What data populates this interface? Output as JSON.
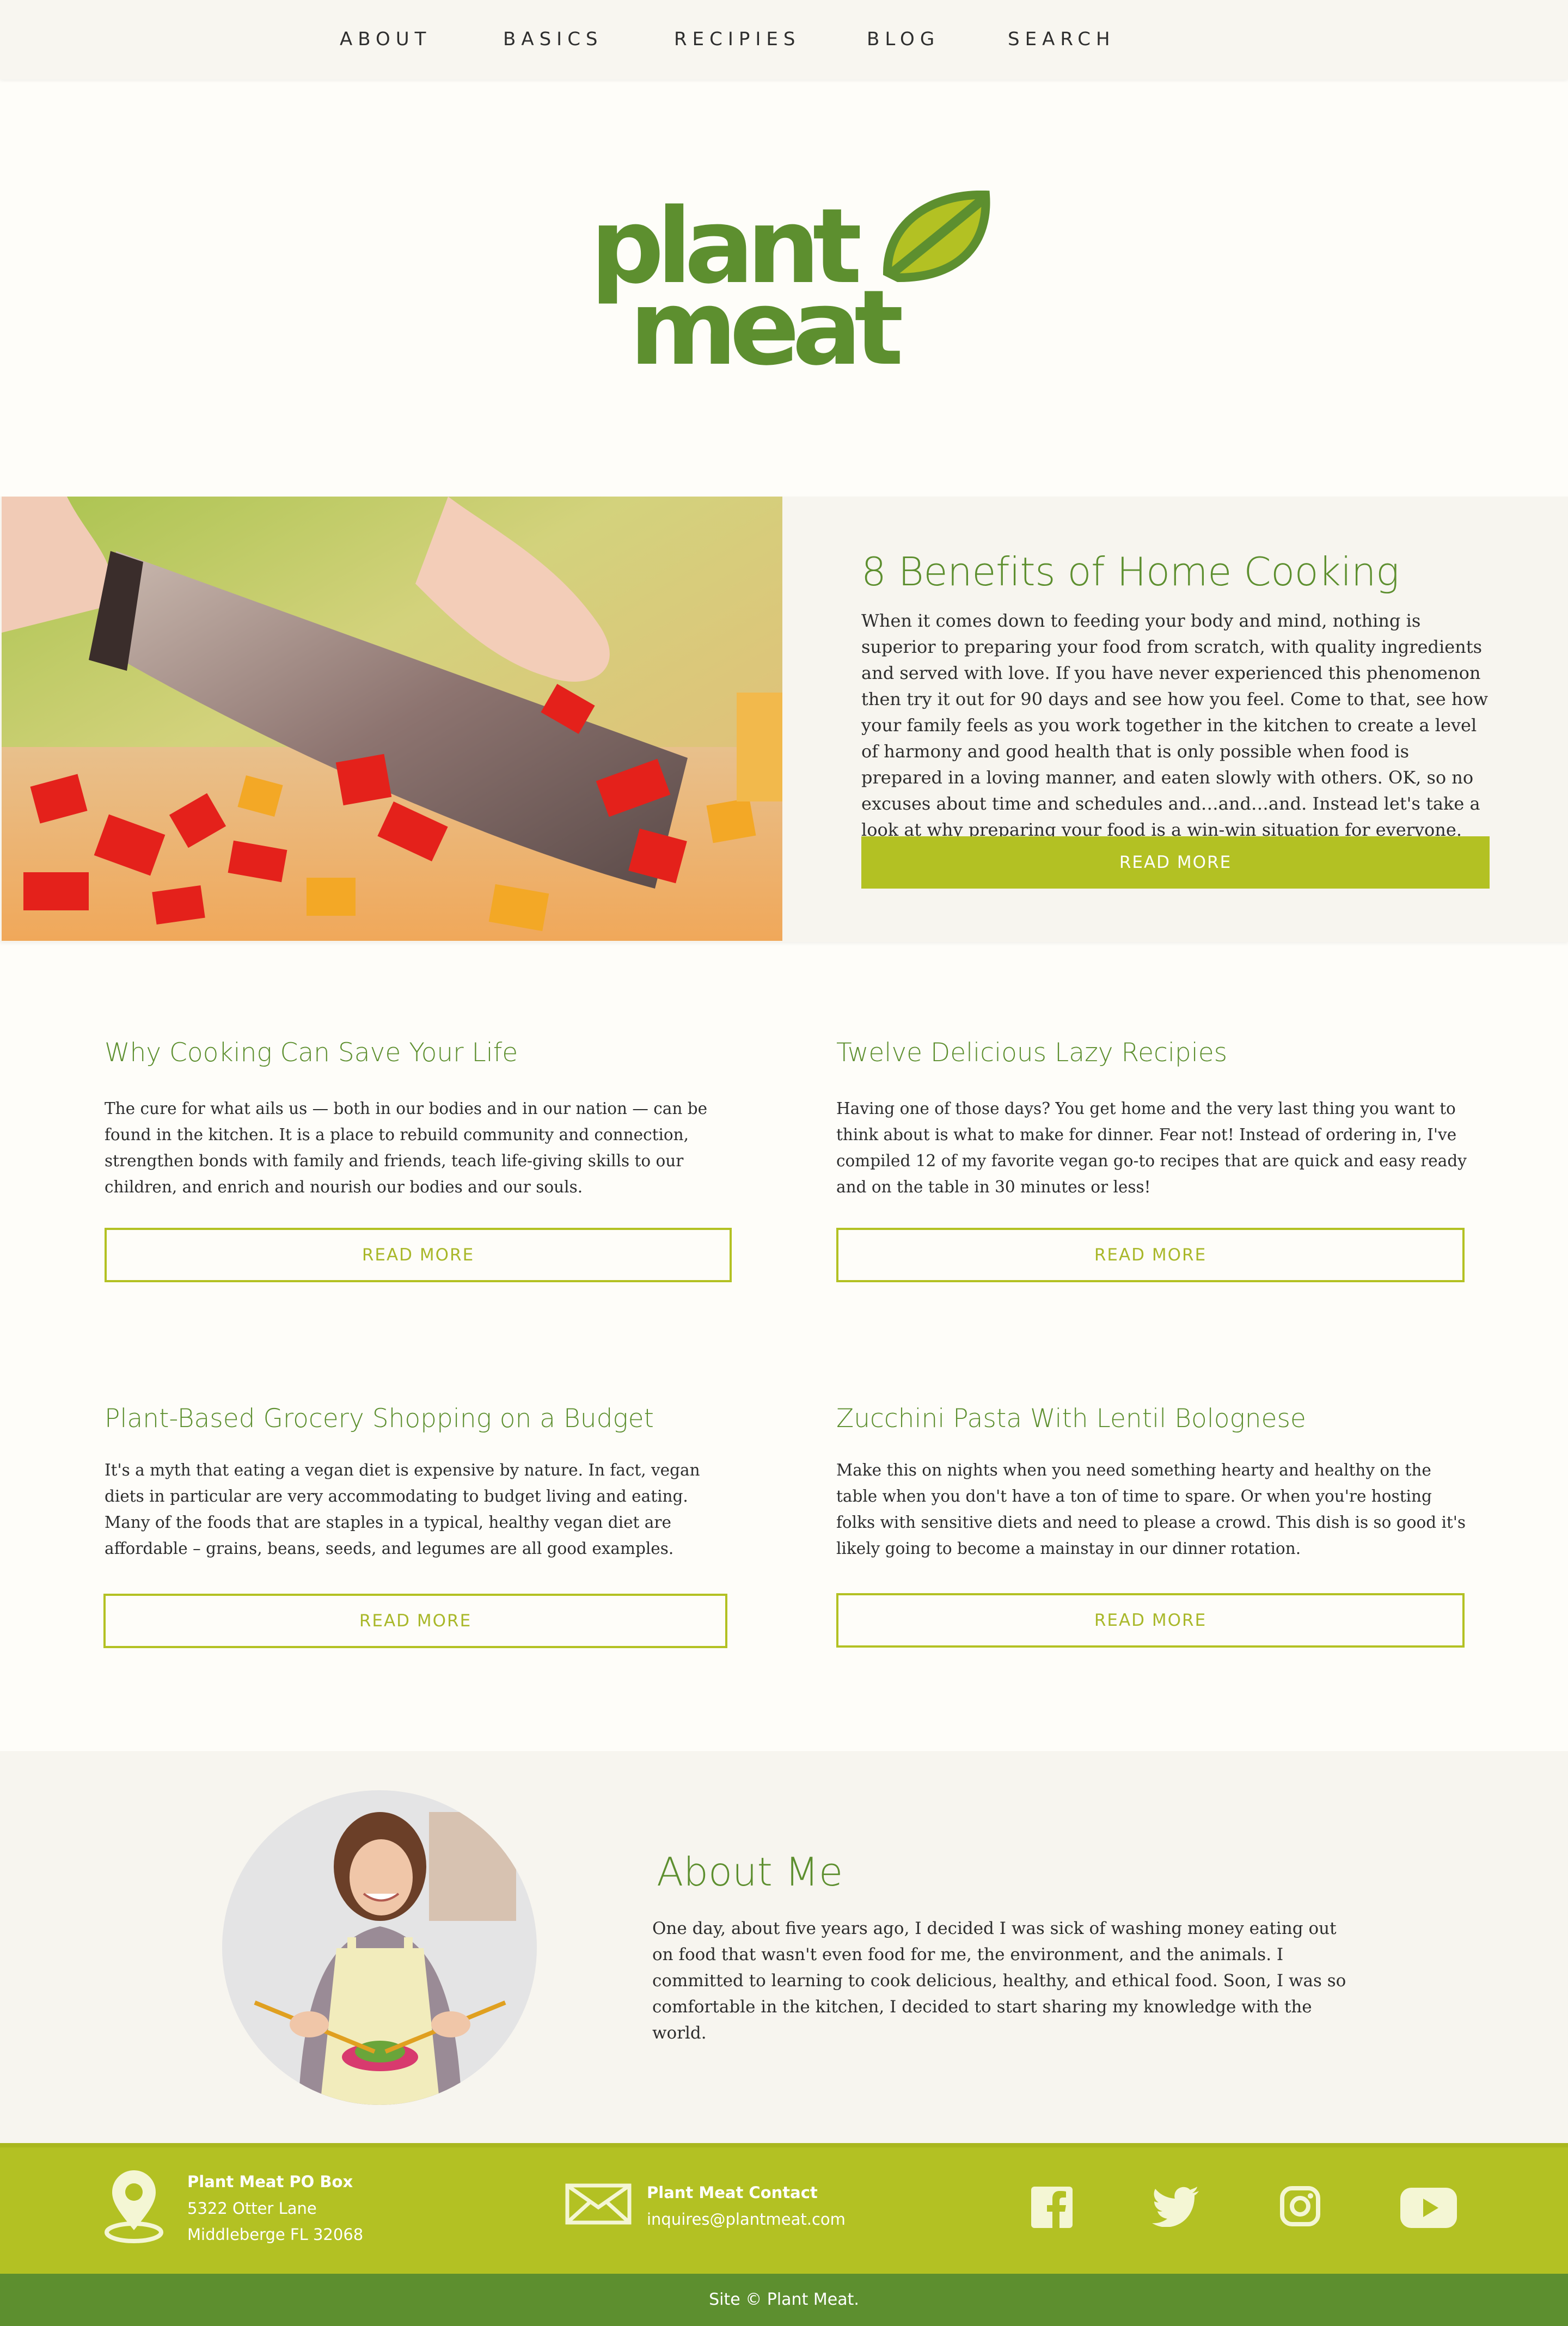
{
  "nav": {
    "items": [
      "ABOUT",
      "BASICS",
      "RECIPIES",
      "BLOG",
      "SEARCH"
    ]
  },
  "logo": {
    "line1": "plant",
    "line2": "meat"
  },
  "hero": {
    "title": "8 Benefits of Home Cooking",
    "text": "When it comes down to feeding your body and mind, nothing is superior to preparing your food from scratch, with quality ingredients and served with love.  If you have never experienced this phenomenon then try it out for 90 days and see how you feel. Come to that, see how your family feels as you work together in the kitchen to create a level of harmony and good health that is only possible when food is prepared in a loving manner, and eaten slowly with others. OK, so no excuses about time and schedules and…and…and. Instead let's take a look at why preparing your food is a win-win situation for everyone.",
    "button": "READ MORE"
  },
  "posts": [
    {
      "title": "Why Cooking Can Save Your Life",
      "text": "The cure for what ails us — both in our bodies and in our nation — can be found in the kitchen. It is a place to rebuild community and connection, strengthen bonds with family and friends, teach life-giving skills to our children, and enrich and nourish our bodies and our souls.",
      "button": "READ MORE"
    },
    {
      "title": "Twelve Delicious Lazy Recipies",
      "text": "Having one of those days? You get home and the very last thing you want to think about is what to make for dinner. Fear not! Instead of ordering in, I've compiled 12 of my favorite vegan go-to recipes that are quick and easy ready and on the table in 30 minutes or less!",
      "button": "READ MORE"
    },
    {
      "title": "Plant-Based Grocery Shopping on a Budget",
      "text": "It's a myth that eating a vegan diet is expensive by nature. In fact, vegan diets in particular are very accommodating to budget living and eating. Many of the foods that are staples in a typical, healthy vegan diet are affordable – grains, beans, seeds, and legumes are all good examples.",
      "button": "READ MORE"
    },
    {
      "title": "Zucchini Pasta With Lentil Bolognese",
      "text": "Make this on nights when you need something hearty and healthy on the table when you don't have a ton of time to spare. Or when you're hosting folks with sensitive diets and need to please a crowd. This dish is so good it's likely going to become a mainstay in our dinner rotation.",
      "button": "READ MORE"
    }
  ],
  "about": {
    "title": "About Me",
    "text": "One day, about five years ago, I decided I was sick of washing money eating out on food that wasn't even food for me, the environment, and the animals. I committed to learning to cook delicious, healthy, and ethical food. Soon, I was so comfortable in the kitchen, I decided to start sharing my knowledge with the world."
  },
  "footer": {
    "address_title": "Plant Meat PO Box",
    "address_line1": "5322 Otter Lane",
    "address_line2": "Middleberge FL 32068",
    "contact_title": "Plant Meat Contact",
    "contact_email": "inquires@plantmeat.com",
    "social": [
      "facebook-icon",
      "twitter-icon",
      "instagram-icon",
      "youtube-icon"
    ],
    "copyright": "Site © Plant Meat."
  },
  "colors": {
    "brand_green": "#5d8f2f",
    "accent_lime": "#b3c123",
    "background": "#fefdf9",
    "panel": "#f7f5ef"
  }
}
